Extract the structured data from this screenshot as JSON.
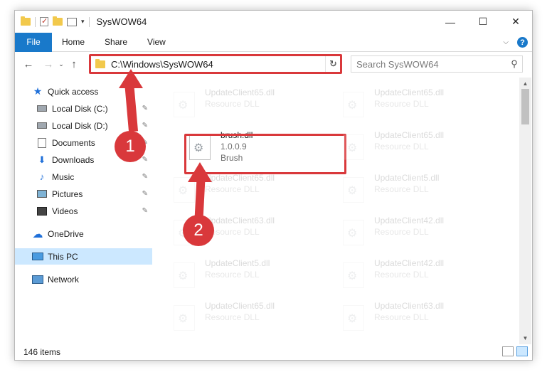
{
  "window": {
    "title": "SysWOW64",
    "controls": {
      "minimize": "—",
      "maximize": "☐",
      "close": "✕"
    }
  },
  "ribbon": {
    "tabs": [
      "File",
      "Home",
      "Share",
      "View"
    ],
    "help_icon": "?",
    "expand_icon": "⌵"
  },
  "nav": {
    "back": "←",
    "forward": "→",
    "recent": "⌄",
    "up": "↑",
    "address": "C:\\Windows\\SysWOW64",
    "address_dropdown": "⌵",
    "refresh": "↻",
    "search_placeholder": "Search SysWOW64",
    "search_icon": "⚲"
  },
  "sidebar": {
    "items": [
      {
        "label": "Quick access",
        "icon": "star-icon",
        "pinned": false
      },
      {
        "label": "Local Disk (C:)",
        "icon": "drive-icon",
        "pinned": true
      },
      {
        "label": "Local Disk (D:)",
        "icon": "drive-icon",
        "pinned": true
      },
      {
        "label": "Documents",
        "icon": "documents-icon",
        "pinned": true
      },
      {
        "label": "Downloads",
        "icon": "download-icon",
        "pinned": true
      },
      {
        "label": "Music",
        "icon": "music-icon",
        "pinned": true
      },
      {
        "label": "Pictures",
        "icon": "pictures-icon",
        "pinned": true
      },
      {
        "label": "Videos",
        "icon": "videos-icon",
        "pinned": true
      },
      {
        "label": "OneDrive",
        "icon": "cloud-icon",
        "pinned": false
      },
      {
        "label": "This PC",
        "icon": "computer-icon",
        "pinned": false,
        "selected": true
      },
      {
        "label": "Network",
        "icon": "network-icon",
        "pinned": false
      }
    ],
    "pin_glyph": "📌"
  },
  "files": [
    {
      "name": "UpdateClient65.dll",
      "type": "Resource DLL",
      "faded": true
    },
    {
      "name": "UpdateClient65.dll",
      "type": "Resource DLL",
      "faded": true
    },
    {
      "name": "brush.dll",
      "version": "1.0.0.9",
      "type": "Brush",
      "faded": false
    },
    {
      "name": "UpdateClient65.dll",
      "type": "Resource DLL",
      "faded": true
    },
    {
      "name": "UpdateClient65.dll",
      "type": "Resource DLL",
      "faded": true
    },
    {
      "name": "UpdateClient5.dll",
      "type": "Resource DLL",
      "faded": true
    },
    {
      "name": "UpdateClient63.dll",
      "type": "Resource DLL",
      "faded": true
    },
    {
      "name": "UpdateClient42.dll",
      "type": "Resource DLL",
      "faded": true
    },
    {
      "name": "UpdateClient5.dll",
      "type": "Resource DLL",
      "faded": true
    },
    {
      "name": "UpdateClient42.dll",
      "type": "Resource DLL",
      "faded": true
    },
    {
      "name": "UpdateClient65.dll",
      "type": "Resource DLL",
      "faded": true
    },
    {
      "name": "UpdateClient63.dll",
      "type": "Resource DLL",
      "faded": true
    }
  ],
  "status": {
    "item_count": "146 items"
  },
  "annotations": {
    "callout_1": "1",
    "callout_2": "2",
    "color": "#d9383b"
  }
}
